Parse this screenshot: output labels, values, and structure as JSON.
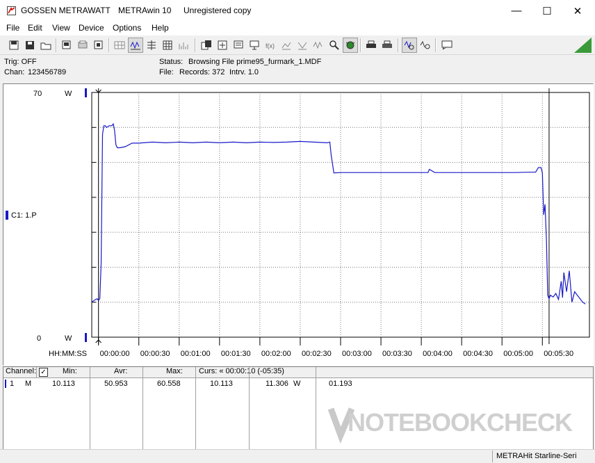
{
  "window": {
    "titles": [
      "GOSSEN METRAWATT",
      "METRAwin 10",
      "Unregistered copy"
    ],
    "minimize_glyph": "—",
    "maximize_glyph": "☐",
    "close_glyph": "✕"
  },
  "menu": [
    "File",
    "Edit",
    "View",
    "Device",
    "Options",
    "Help"
  ],
  "toolbar": {
    "icons": [
      "open-icon",
      "save-icon",
      "folder-icon",
      "device-icon",
      "print-icon",
      "chart-icon",
      "grid-icon",
      "wave-icon",
      "list-icon",
      "table-icon",
      "bars-icon",
      "copy-icon",
      "export-icon",
      "graph-icon",
      "computer-icon",
      "fx-icon",
      "scale-icon",
      "scale2-icon",
      "signal-icon",
      "search-icon",
      "bug-icon",
      "printer-icon",
      "printer2-icon",
      "zoom-icon",
      "zoom-out-icon",
      "message-icon"
    ]
  },
  "info": {
    "trig": "Trig: OFF",
    "chan_label": "Chan:",
    "chan_value": "123456789",
    "status_label": "Status:",
    "status_value": "Browsing File prime95_furmark_1.MDF",
    "file_label": "File:",
    "file_value": "Records: 372",
    "interval": "Intrv. 1.0"
  },
  "chart_data": {
    "type": "line",
    "y_top": "70",
    "y_bottom": "0",
    "y_unit": "W",
    "ylim": [
      0,
      70
    ],
    "xlim": [
      -5,
      365
    ],
    "channel_label": "C1: 1.P",
    "x_axis_label": "HH:MM:SS",
    "tick_labels": [
      "00:00:00",
      "00:00:30",
      "00:01:00",
      "00:01:30",
      "00:02:00",
      "00:02:30",
      "00:03:00",
      "00:03:30",
      "00:04:00",
      "00:04:30",
      "00:05:00",
      "00:05:30"
    ],
    "tick_seconds": [
      0,
      30,
      60,
      90,
      120,
      150,
      180,
      210,
      240,
      270,
      300,
      330
    ],
    "cursors_seconds": [
      0,
      335
    ],
    "series": [
      {
        "color": "#1818c8",
        "x": [
          -5,
          -3,
          -1,
          0,
          1,
          2,
          3,
          4,
          5,
          6,
          8,
          10,
          11,
          12,
          13,
          14,
          16,
          20,
          25,
          30,
          40,
          50,
          60,
          70,
          80,
          90,
          100,
          110,
          120,
          130,
          140,
          150,
          160,
          170,
          172,
          173,
          175,
          180,
          190,
          200,
          220,
          240,
          245,
          246,
          250,
          270,
          290,
          300,
          310,
          320,
          325,
          327,
          329,
          330,
          331,
          332,
          333,
          334,
          335,
          336,
          338,
          340,
          342,
          344,
          345,
          346,
          348,
          350,
          352,
          354,
          356,
          358,
          360,
          362
        ],
        "y": [
          10,
          10.6,
          11,
          10.5,
          11,
          21,
          58,
          60.5,
          60.5,
          60,
          60.5,
          60.5,
          61,
          59,
          55,
          54.2,
          54.2,
          54.5,
          55.5,
          55.5,
          55.8,
          55.6,
          55.8,
          55.6,
          55.8,
          55.6,
          55.8,
          55.6,
          55.8,
          55.7,
          55.8,
          56,
          55.8,
          55.6,
          55.8,
          52,
          47,
          47.1,
          47.1,
          47.1,
          47.1,
          47.1,
          47.1,
          48,
          47.1,
          47.1,
          47.1,
          47.1,
          47.1,
          47.2,
          47.2,
          48.5,
          48.5,
          47,
          35,
          38,
          28,
          12,
          11,
          12,
          11.5,
          12.5,
          10.8,
          16,
          11.3,
          18.5,
          13,
          19,
          10,
          13,
          12,
          11,
          10,
          9.5
        ]
      }
    ]
  },
  "table": {
    "headers": {
      "channel": "Channel:",
      "min": "Min:",
      "avr": "Avr:",
      "max": "Max:",
      "curs": "Curs: « 00:00:10 (-05:35)"
    },
    "row": {
      "num": "1",
      "mode": "M",
      "min": "10.113",
      "avr": "50.953",
      "max": "60.558",
      "c1": "10.113",
      "c2": "11.306",
      "unit": "W",
      "c3": "01.193"
    }
  },
  "watermark": "NOTEBOOKCHECK",
  "statusbar": "METRAHit Starline-Seri"
}
